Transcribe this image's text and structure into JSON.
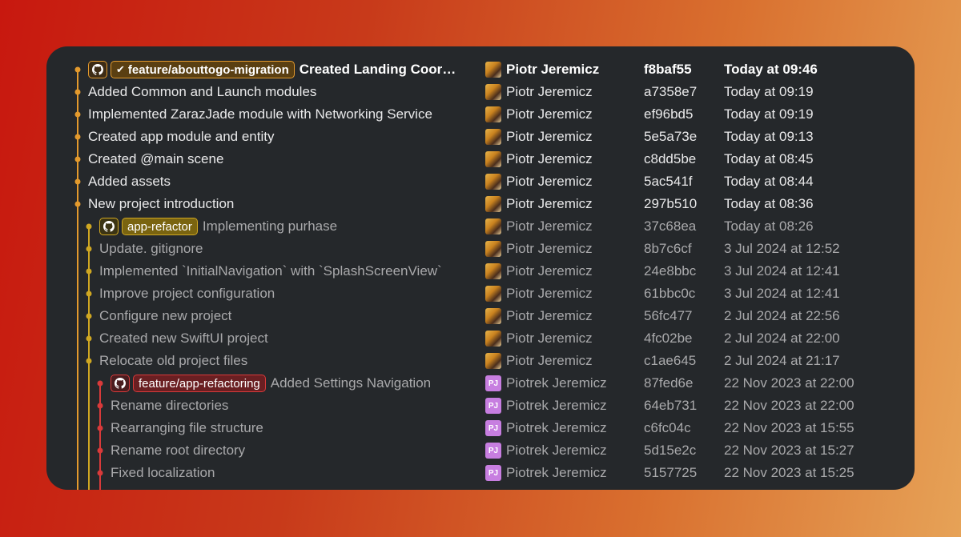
{
  "colors": {
    "orange": "#e39a2d",
    "yellow": "#cfa722",
    "red": "#d93a3a"
  },
  "commits": [
    {
      "message": "Created Landing Coor…",
      "author": "Piotr Jeremicz",
      "hash": "f8baf55",
      "date": "Today at 09:46",
      "branch": "feature/abouttogo-migration",
      "branch_checked": true,
      "lane": 0,
      "avatar": "photo"
    },
    {
      "message": "Added Common and Launch modules",
      "author": "Piotr Jeremicz",
      "hash": "a7358e7",
      "date": "Today at 09:19",
      "lane": 0,
      "avatar": "photo"
    },
    {
      "message": "Implemented ZarazJade module with Networking Service",
      "author": "Piotr Jeremicz",
      "hash": "ef96bd5",
      "date": "Today at 09:19",
      "lane": 0,
      "avatar": "photo"
    },
    {
      "message": "Created app module and entity",
      "author": "Piotr Jeremicz",
      "hash": "5e5a73e",
      "date": "Today at 09:13",
      "lane": 0,
      "avatar": "photo"
    },
    {
      "message": "Created @main scene",
      "author": "Piotr Jeremicz",
      "hash": "c8dd5be",
      "date": "Today at 08:45",
      "lane": 0,
      "avatar": "photo"
    },
    {
      "message": "Added assets",
      "author": "Piotr Jeremicz",
      "hash": "5ac541f",
      "date": "Today at 08:44",
      "lane": 0,
      "avatar": "photo"
    },
    {
      "message": "New project introduction",
      "author": "Piotr Jeremicz",
      "hash": "297b510",
      "date": "Today at 08:36",
      "lane": 0,
      "avatar": "photo"
    },
    {
      "message": "Implementing purhase",
      "author": "Piotr Jeremicz",
      "hash": "37c68ea",
      "date": "Today at 08:26",
      "branch": "app-refactor",
      "lane": 1,
      "avatar": "photo"
    },
    {
      "message": "Update. gitignore",
      "author": "Piotr Jeremicz",
      "hash": "8b7c6cf",
      "date": "3 Jul 2024 at 12:52",
      "lane": 1,
      "avatar": "photo"
    },
    {
      "message": "Implemented `InitialNavigation` with `SplashScreenView`",
      "author": "Piotr Jeremicz",
      "hash": "24e8bbc",
      "date": "3 Jul 2024 at 12:41",
      "lane": 1,
      "avatar": "photo"
    },
    {
      "message": "Improve project configuration",
      "author": "Piotr Jeremicz",
      "hash": "61bbc0c",
      "date": "3 Jul 2024 at 12:41",
      "lane": 1,
      "avatar": "photo"
    },
    {
      "message": "Configure new project",
      "author": "Piotr Jeremicz",
      "hash": "56fc477",
      "date": "2 Jul 2024 at 22:56",
      "lane": 1,
      "avatar": "photo"
    },
    {
      "message": "Created new SwiftUI project",
      "author": "Piotr Jeremicz",
      "hash": "4fc02be",
      "date": "2 Jul 2024 at 22:00",
      "lane": 1,
      "avatar": "photo"
    },
    {
      "message": "Relocate old project files",
      "author": "Piotr Jeremicz",
      "hash": "c1ae645",
      "date": "2 Jul 2024 at 21:17",
      "lane": 1,
      "avatar": "photo"
    },
    {
      "message": "Added Settings Navigation",
      "author": "Piotrek Jeremicz",
      "hash": "87fed6e",
      "date": "22 Nov 2023 at 22:00",
      "branch": "feature/app-refactoring",
      "lane": 2,
      "avatar": "PJ"
    },
    {
      "message": "Rename directories",
      "author": "Piotrek Jeremicz",
      "hash": "64eb731",
      "date": "22 Nov 2023 at 22:00",
      "lane": 2,
      "avatar": "PJ"
    },
    {
      "message": "Rearranging file structure",
      "author": "Piotrek Jeremicz",
      "hash": "c6fc04c",
      "date": "22 Nov 2023 at 15:55",
      "lane": 2,
      "avatar": "PJ"
    },
    {
      "message": "Rename root directory",
      "author": "Piotrek Jeremicz",
      "hash": "5d15e2c",
      "date": "22 Nov 2023 at 15:27",
      "lane": 2,
      "avatar": "PJ"
    },
    {
      "message": "Fixed localization",
      "author": "Piotrek Jeremicz",
      "hash": "5157725",
      "date": "22 Nov 2023 at 15:25",
      "lane": 2,
      "avatar": "PJ"
    }
  ]
}
